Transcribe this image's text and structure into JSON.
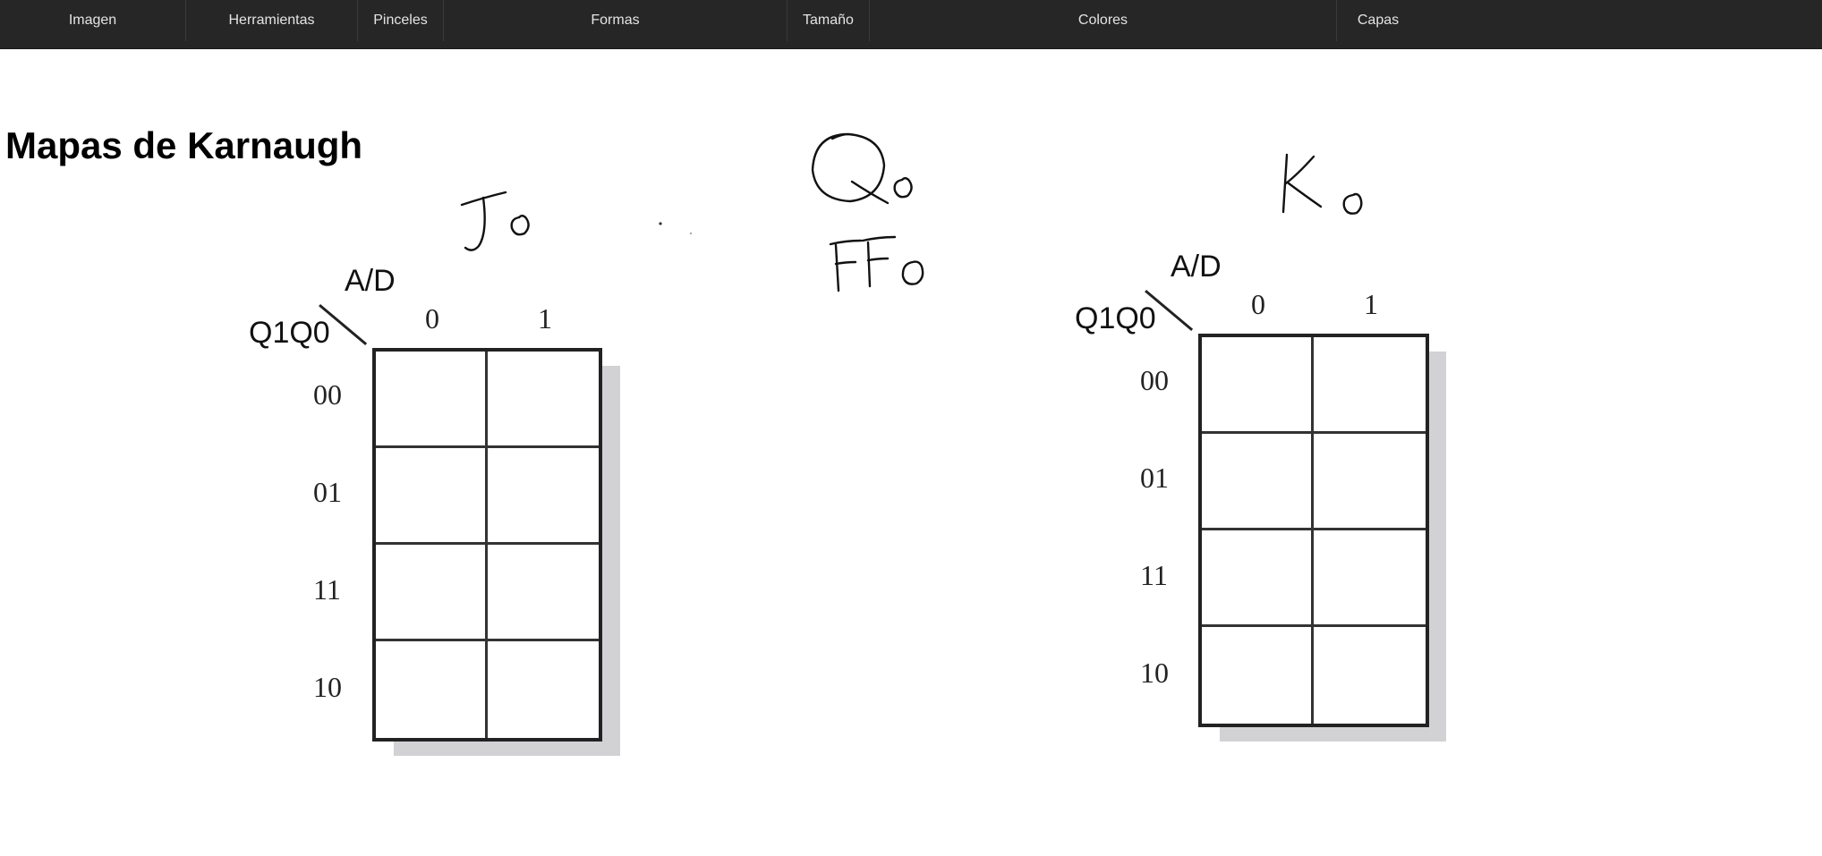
{
  "toolbar": {
    "groups": [
      "Imagen",
      "Herramientas",
      "Pinceles",
      "Formas",
      "Tamaño",
      "Colores",
      "Capas"
    ]
  },
  "page": {
    "title": "Mapas de Karnaugh"
  },
  "kmaps": [
    {
      "row_var": "Q1Q0",
      "col_var": "A/D",
      "col_labels": [
        "0",
        "1"
      ],
      "row_labels": [
        "00",
        "01",
        "11",
        "10"
      ],
      "cells": [
        [
          "",
          ""
        ],
        [
          "",
          ""
        ],
        [
          "",
          ""
        ],
        [
          "",
          ""
        ]
      ]
    },
    {
      "row_var": "Q1Q0",
      "col_var": "A/D",
      "col_labels": [
        "0",
        "1"
      ],
      "row_labels": [
        "00",
        "01",
        "11",
        "10"
      ],
      "cells": [
        [
          "",
          ""
        ],
        [
          "",
          ""
        ],
        [
          "",
          ""
        ],
        [
          "",
          ""
        ]
      ]
    }
  ],
  "handwriting": [
    "J0",
    "Q0",
    "FF0",
    "K0"
  ],
  "colors": {
    "toolbar_bg": "#262626",
    "toolbar_text": "#e4e4e4",
    "grid_shadow": "#d2d2d5"
  }
}
